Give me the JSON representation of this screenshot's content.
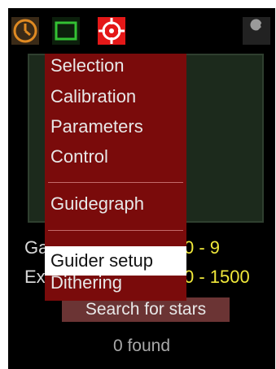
{
  "toolbar": {
    "icons": [
      "clock-icon",
      "rectangle-icon",
      "crosshair-icon",
      "wrench-icon"
    ],
    "accent": "#e41818"
  },
  "settings": {
    "gain_label": "Ga",
    "gain_value": "0 - 9",
    "exposure_label": "Ex",
    "exposure_value": "0 - 1500"
  },
  "search": {
    "button_label": "Search for stars",
    "found_text": "0 found"
  },
  "menu": {
    "items": [
      {
        "label": "Selection"
      },
      {
        "label": "Calibration"
      },
      {
        "label": "Parameters"
      },
      {
        "label": "Control"
      },
      {
        "label": "Guidegraph"
      },
      {
        "label": "Guider setup",
        "selected": true
      },
      {
        "label": "Dithering"
      }
    ]
  }
}
